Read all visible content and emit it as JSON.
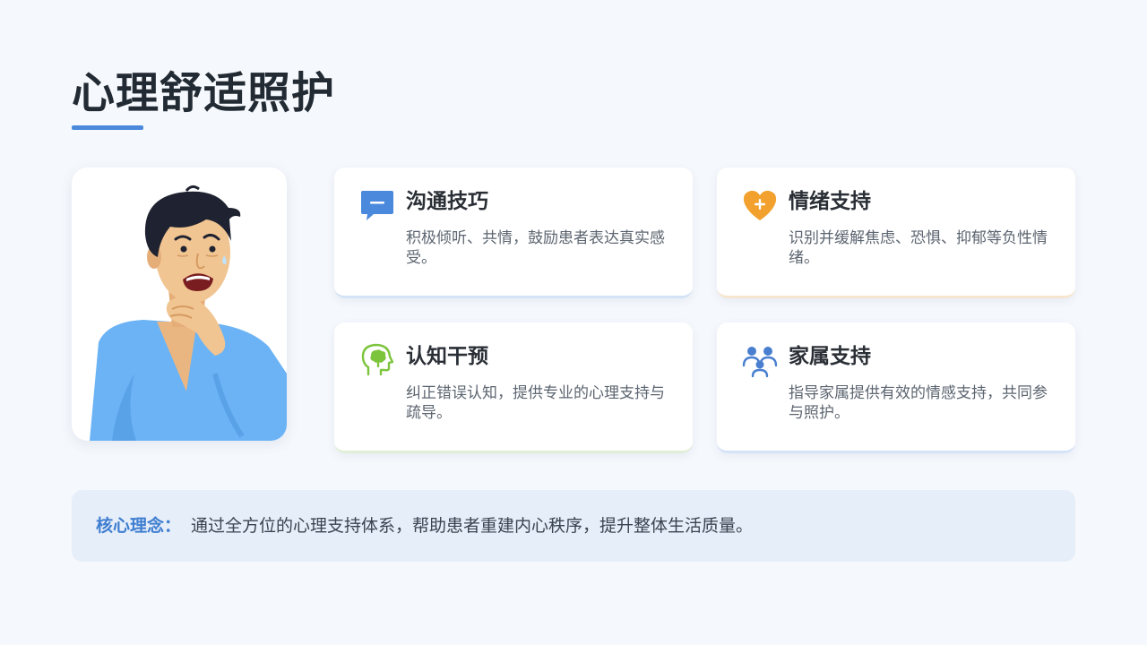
{
  "page": {
    "title": "心理舒适照护"
  },
  "cards": [
    {
      "icon": "chat-bubble-icon",
      "title": "沟通技巧",
      "desc": "积极倾听、共情，鼓励患者表达真实感受。"
    },
    {
      "icon": "heart-plus-icon",
      "title": "情绪支持",
      "desc": "识别并缓解焦虑、恐惧、抑郁等负性情绪。"
    },
    {
      "icon": "head-brain-icon",
      "title": "认知干预",
      "desc": "纠正错误认知，提供专业的心理支持与疏导。"
    },
    {
      "icon": "family-group-icon",
      "title": "家属支持",
      "desc": "指导家属提供有效的情感支持，共同参与照护。"
    }
  ],
  "banner": {
    "label": "核心理念：",
    "text": "通过全方位的心理支持体系，帮助患者重建内心秩序，提升整体生活质量。"
  },
  "colors": {
    "accent_blue": "#4a89dc",
    "heart_orange": "#f2a12e",
    "brain_green": "#7cc43c",
    "family_blue": "#4a7fd0",
    "banner_bg": "#e6eef9",
    "page_bg": "#f5f8fc"
  },
  "illustration": {
    "icon": "anxious-man-illustration"
  }
}
